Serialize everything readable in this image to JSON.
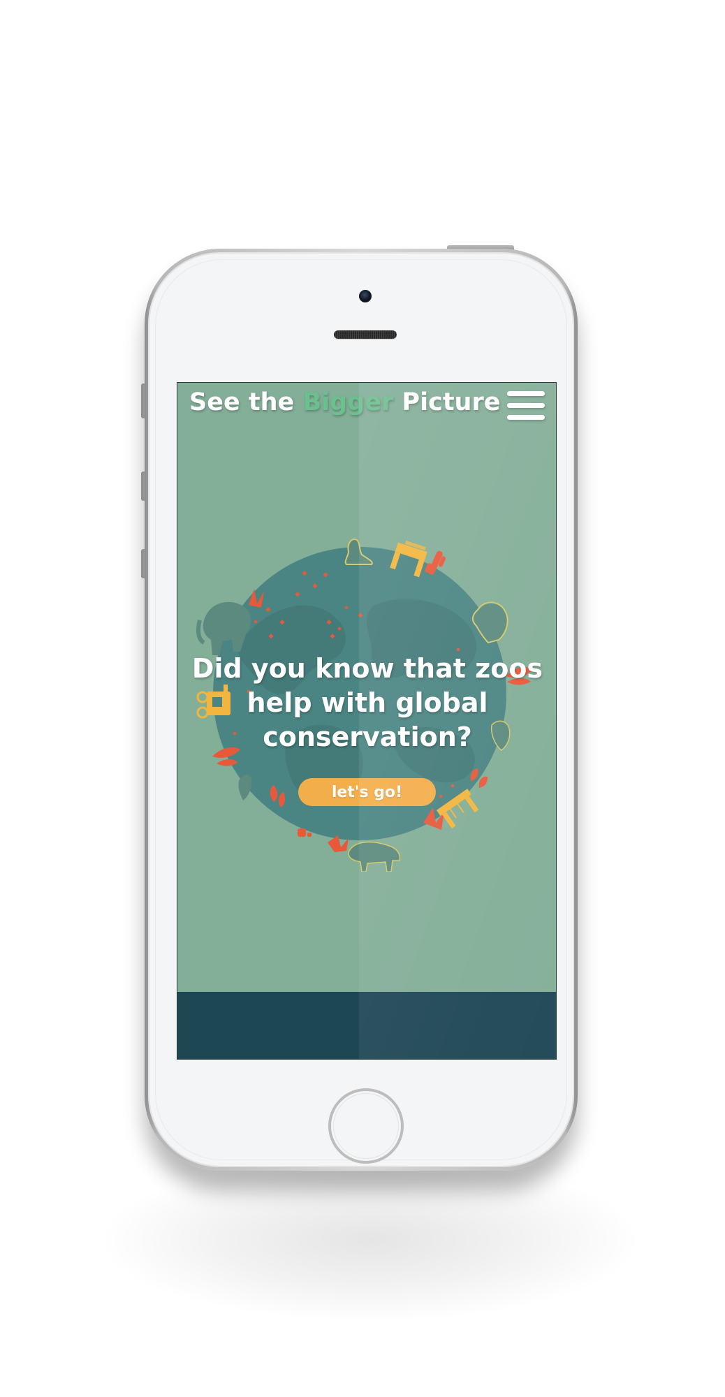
{
  "header": {
    "title_prefix": "See the",
    "title_accent": "Bigger",
    "title_suffix": "Picture",
    "menu_icon": "hamburger-menu-icon"
  },
  "hero": {
    "headline": "Did you know that zoos help with global conservation?",
    "cta_label": "let's go!"
  },
  "illustration": {
    "name": "globe-with-animals",
    "icons": [
      "globe-icon",
      "seal-icon",
      "zoo-sign-icon",
      "cactus-icon",
      "bear-icon",
      "elephant-icon",
      "rhino-icon",
      "buffalo-icon",
      "jeep-icon",
      "plant-icon"
    ]
  },
  "colors": {
    "screen_background": "#83ae98",
    "brand_accent": "#6cc08e",
    "globe": "#4b8583",
    "cta": "#f3ae4c",
    "footer_band": "#1e4754",
    "illustration_red": "#e8593a",
    "illustration_yellow": "#f2b63e"
  }
}
